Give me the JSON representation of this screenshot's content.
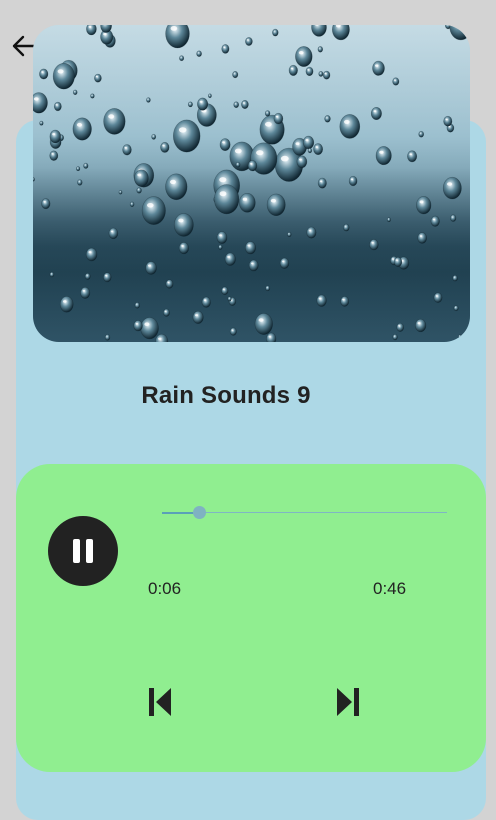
{
  "header": {
    "back_icon": "arrow-back-icon"
  },
  "artwork": {
    "icon": "rain-drops-image"
  },
  "track": {
    "title": "Rain Sounds 9"
  },
  "player": {
    "state": "playing",
    "play_pause_icon": "pause-icon",
    "current_time": "0:06",
    "total_time": "0:46",
    "progress_fraction": 0.13,
    "prev_icon": "skip-previous-icon",
    "next_icon": "skip-next-icon"
  },
  "colors": {
    "background": "#d3d3d3",
    "card": "#add8e6",
    "player": "#90ee90",
    "button": "#222222"
  }
}
